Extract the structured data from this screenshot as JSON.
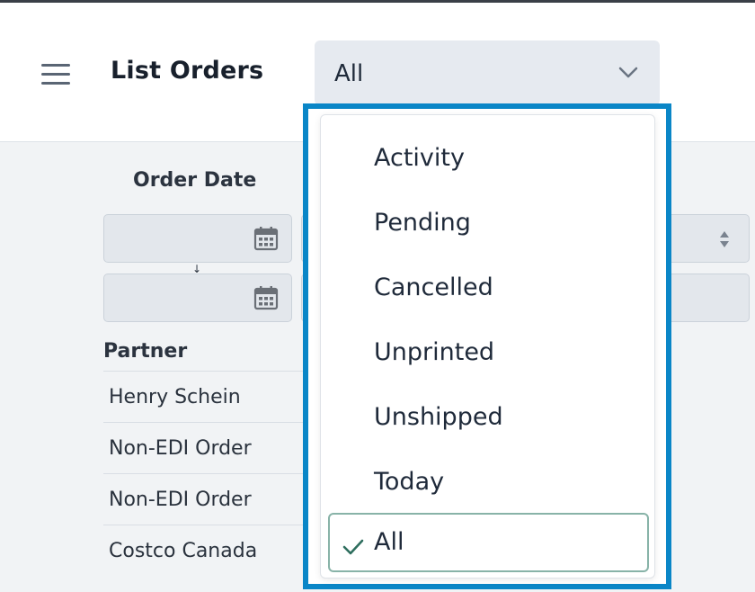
{
  "header": {
    "title": "List Orders",
    "filter_value": "All"
  },
  "table": {
    "order_date_label": "Order Date",
    "partner_label": "Partner",
    "rows": [
      "Henry Schein",
      "Non-EDI Order",
      "Non-EDI Order",
      "Costco Canada"
    ]
  },
  "dropdown": {
    "options": [
      "Activity",
      "Pending",
      "Cancelled",
      "Unprinted",
      "Unshipped",
      "Today",
      "All"
    ],
    "selected": "All"
  },
  "colors": {
    "focus_outline": "#0a86c7",
    "check": "#2e6e5e",
    "selected_border": "#88b3a8"
  }
}
